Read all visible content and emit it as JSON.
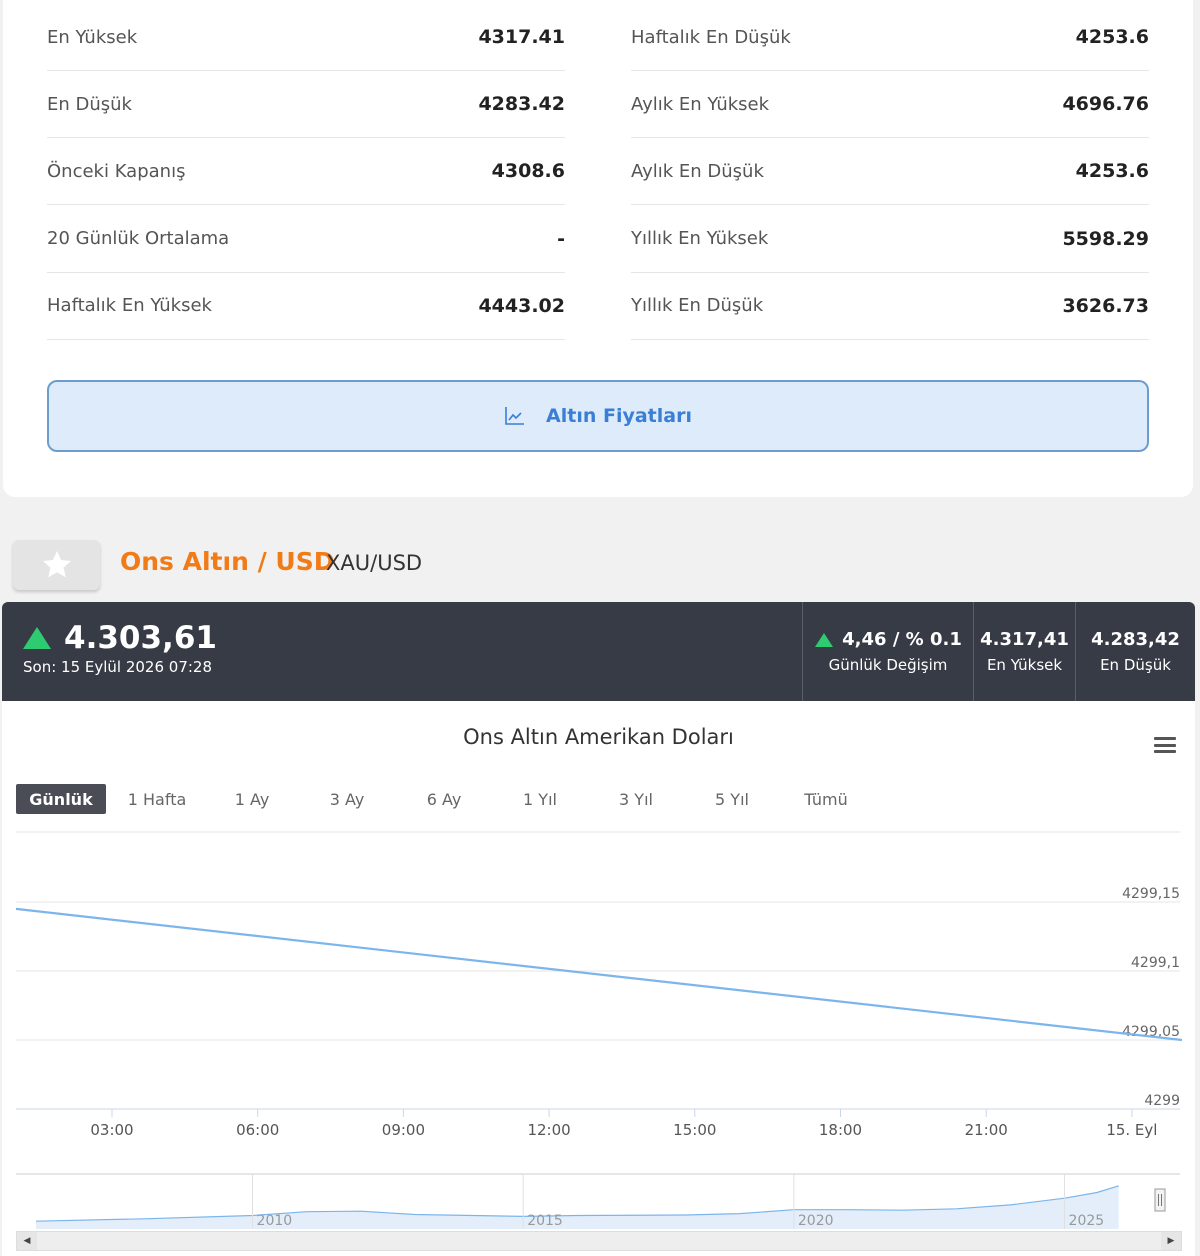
{
  "stats": {
    "left": [
      {
        "label": "En Yüksek",
        "value": "4317.41"
      },
      {
        "label": "En Düşük",
        "value": "4283.42"
      },
      {
        "label": "Önceki Kapanış",
        "value": "4308.6"
      },
      {
        "label": "20 Günlük Ortalama",
        "value": "-"
      },
      {
        "label": "Haftalık En Yüksek",
        "value": "4443.02"
      }
    ],
    "right": [
      {
        "label": "Haftalık En Düşük",
        "value": "4253.6"
      },
      {
        "label": "Aylık En Yüksek",
        "value": "4696.76"
      },
      {
        "label": "Aylık En Düşük",
        "value": "4253.6"
      },
      {
        "label": "Yıllık En Yüksek",
        "value": "5598.29"
      },
      {
        "label": "Yıllık En Düşük",
        "value": "3626.73"
      }
    ]
  },
  "prices_button": {
    "label": "Altın Fiyatları",
    "icon": "line-chart-icon"
  },
  "instrument": {
    "title": "Ons Altın / USD",
    "symbol": "XAU/USD",
    "favorite_icon": "star-icon"
  },
  "quote": {
    "price": "4.303,61",
    "updated": "Son: 15 Eylül 2026 07:28",
    "change": {
      "value": "4,46 / % 0.1",
      "label": "Günlük Değişim"
    },
    "high": {
      "value": "4.317,41",
      "label": "En Yüksek"
    },
    "low": {
      "value": "4.283,42",
      "label": "En Düşük"
    },
    "up_color": "#2ecc71"
  },
  "range_buttons": [
    "Günlük",
    "1 Hafta",
    "1 Ay",
    "3 Ay",
    "6 Ay",
    "1 Yıl",
    "3 Yıl",
    "5 Yıl",
    "Tümü"
  ],
  "active_range": "Günlük",
  "chart_data": {
    "type": "line",
    "title": "Ons Altın Amerikan Doları",
    "x_ticks": [
      "03:00",
      "06:00",
      "09:00",
      "12:00",
      "15:00",
      "18:00",
      "21:00",
      "15. Eyl"
    ],
    "y_ticks": [
      "4299",
      "4299,05",
      "4299,1",
      "4299,15"
    ],
    "ylim": [
      4299,
      4299.15
    ],
    "x": [
      "2026-09-14 01:00",
      "2026-09-15 01:00"
    ],
    "y": [
      4299.145,
      4299.05
    ],
    "line_color": "#7cb5ec",
    "grid": true,
    "navigator": {
      "year_labels": [
        "2010",
        "2015",
        "2020",
        "2025"
      ],
      "years": [
        2006,
        2008,
        2010,
        2011,
        2012,
        2013,
        2015,
        2016,
        2018,
        2019,
        2020,
        2021,
        2022,
        2023,
        2024,
        2025,
        2025.6,
        2026
      ],
      "values": [
        600,
        850,
        1200,
        1600,
        1650,
        1300,
        1100,
        1200,
        1250,
        1400,
        1800,
        1800,
        1750,
        1900,
        2300,
        3000,
        3600,
        4300
      ]
    }
  }
}
